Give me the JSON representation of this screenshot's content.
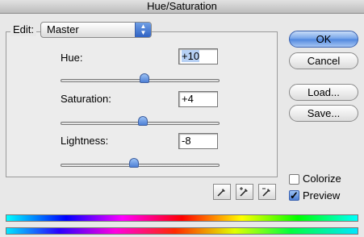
{
  "window": {
    "title": "Hue/Saturation"
  },
  "edit": {
    "label": "Edit:",
    "value": "Master"
  },
  "sliders": [
    {
      "label": "Hue:",
      "value": "+10",
      "numeric": 10,
      "min": -180,
      "max": 180
    },
    {
      "label": "Saturation:",
      "value": "+4",
      "numeric": 4,
      "min": -100,
      "max": 100
    },
    {
      "label": "Lightness:",
      "value": "-8",
      "numeric": -8,
      "min": -100,
      "max": 100
    }
  ],
  "buttons": {
    "ok": "OK",
    "cancel": "Cancel",
    "load": "Load...",
    "save": "Save..."
  },
  "checkboxes": {
    "colorize": {
      "label": "Colorize",
      "checked": false
    },
    "preview": {
      "label": "Preview",
      "checked": true
    }
  },
  "colors": {
    "accent": "#4e86de",
    "thumb": "#6f9fe5"
  },
  "icons": [
    "eyedropper-icon",
    "eyedropper-plus-icon",
    "eyedropper-minus-icon"
  ]
}
